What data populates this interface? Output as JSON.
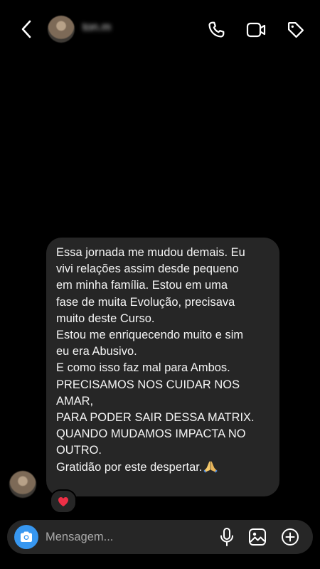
{
  "header": {
    "contact_name": "ton.m",
    "back_icon": "chevron-left-icon",
    "call_icon": "phone-icon",
    "video_icon": "video-camera-icon",
    "tag_icon": "tag-icon"
  },
  "message": {
    "lines": [
      "Essa jornada me mudou demais. Eu",
      "vivi relações assim desde pequeno",
      "em minha família. Estou em uma",
      "fase de muita Evolução, precisava",
      "muito deste Curso.",
      "Estou me enriquecendo muito e sim",
      "eu era Abusivo.",
      "E como isso faz mal para Ambos.",
      "PRECISAMOS NOS CUIDAR NOS",
      "AMAR,",
      "PARA PODER SAIR DESSA MATRIX.",
      "QUANDO MUDAMOS IMPACTA NO",
      "OUTRO."
    ],
    "last_line": "Gratidão por este despertar.",
    "last_line_emoji": "folded-hands-emoji",
    "reaction": "❤️"
  },
  "composer": {
    "placeholder": "Mensagem...",
    "camera_icon": "camera-icon",
    "mic_icon": "microphone-icon",
    "gallery_icon": "image-icon",
    "plus_icon": "plus-circle-icon"
  },
  "colors": {
    "background": "#000000",
    "bubble": "#262626",
    "accent": "#3797f0"
  }
}
